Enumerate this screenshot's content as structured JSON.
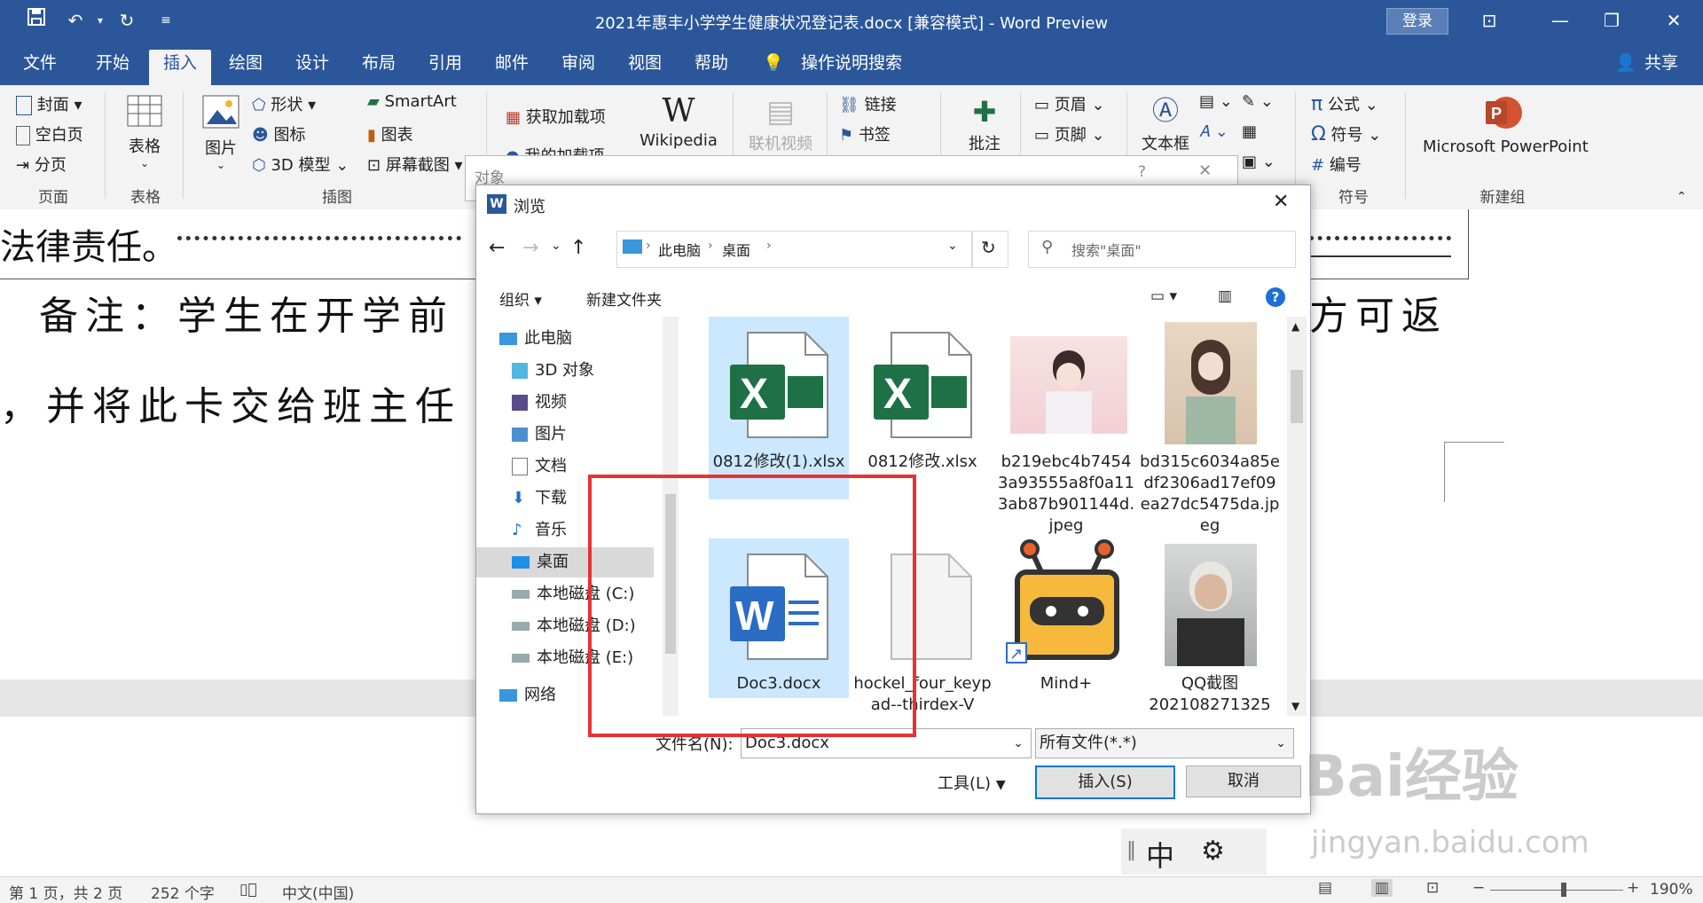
{
  "window": {
    "title": "2021年惠丰小学学生健康状况登记表.docx [兼容模式]  -  Word Preview",
    "login": "登录"
  },
  "tabs": [
    "文件",
    "开始",
    "插入",
    "绘图",
    "设计",
    "布局",
    "引用",
    "邮件",
    "审阅",
    "视图",
    "帮助"
  ],
  "tell_me": "操作说明搜索",
  "share": "共享",
  "ribbon": {
    "pages": {
      "cover": "封面",
      "blank": "空白页",
      "break": "分页",
      "label": "页面"
    },
    "table": {
      "btn": "表格",
      "label": "表格"
    },
    "illustrations": {
      "picture": "图片",
      "shapes": "形状",
      "icons": "图标",
      "model3d": "3D 模型",
      "smartart": "SmartArt",
      "chart": "图表",
      "screenshot": "屏幕截图",
      "label": "插图"
    },
    "addins": {
      "get": "获取加载项",
      "my": "我的加载项",
      "wikipedia": "Wikipedia"
    },
    "media": {
      "online_video": "联机视频"
    },
    "links": {
      "link": "链接",
      "bookmark": "书签"
    },
    "comments": {
      "comment": "批注"
    },
    "headerfooter": {
      "header": "页眉",
      "footer": "页脚"
    },
    "text": {
      "textbox": "文本框"
    },
    "symbols": {
      "equation": "公式",
      "symbol": "符号",
      "number": "编号",
      "label": "符号"
    },
    "newgroup": {
      "ppt": "Microsoft PowerPoint",
      "label": "新建组"
    }
  },
  "document": {
    "line1": "法律责任。",
    "line2a": "备注：学生在开学前",
    "line2b": "方可返",
    "line3": "，并将此卡交给班主任"
  },
  "bg_dialog": {
    "title": "对象",
    "help": "?"
  },
  "dialog": {
    "title": "浏览",
    "breadcrumb": [
      "此电脑",
      "桌面"
    ],
    "search_placeholder": "搜索\"桌面\"",
    "organize": "组织",
    "new_folder": "新建文件夹",
    "nav": [
      "此电脑",
      "3D 对象",
      "视频",
      "图片",
      "文档",
      "下载",
      "音乐",
      "桌面",
      "本地磁盘 (C:)",
      "本地磁盘 (D:)",
      "本地磁盘 (E:)",
      "网络"
    ],
    "files": [
      {
        "name": "0812修改(1).xlsx",
        "kind": "excel"
      },
      {
        "name": "0812修改.xlsx",
        "kind": "excel"
      },
      {
        "name": "b219ebc4b74543a93555a8f0a113ab87b901144d.jpeg",
        "kind": "image"
      },
      {
        "name": "bd315c6034a85edf2306ad17ef09ea27dc5475da.jpeg",
        "kind": "image"
      },
      {
        "name": "Doc3.docx",
        "kind": "word"
      },
      {
        "name": "hockel_four_keypad--thirdex-V",
        "kind": "blank"
      },
      {
        "name": "Mind+",
        "kind": "app"
      },
      {
        "name": "QQ截图202108271325",
        "kind": "image"
      }
    ],
    "filename_label": "文件名(N):",
    "filename_value": "Doc3.docx",
    "filetype": "所有文件(*.*)",
    "tools": "工具(L)",
    "insert": "插入(S)",
    "cancel": "取消"
  },
  "ime": {
    "mode": "中"
  },
  "status": {
    "page": "第 1 页，共 2 页",
    "words": "252 个字",
    "lang": "中文(中国)",
    "zoom": "190%"
  },
  "watermark": {
    "brand": "Bai经验",
    "url": "jingyan.baidu.com"
  },
  "colors": {
    "word_blue": "#2b579a",
    "select": "#cce8ff",
    "highlight": "#e53333",
    "excel": "#1e7145",
    "word": "#2b6cc4"
  }
}
